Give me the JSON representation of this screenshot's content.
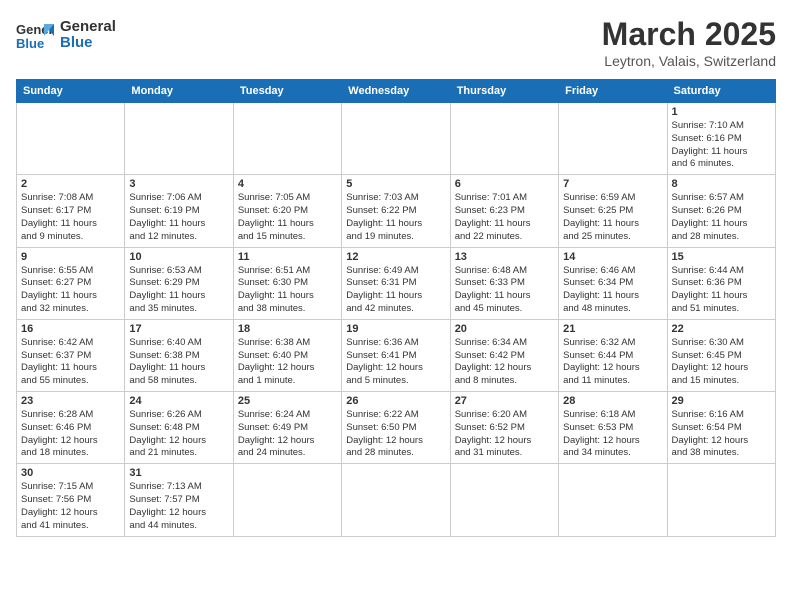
{
  "logo": {
    "line1": "General",
    "line2": "Blue"
  },
  "title": "March 2025",
  "subtitle": "Leytron, Valais, Switzerland",
  "weekdays": [
    "Sunday",
    "Monday",
    "Tuesday",
    "Wednesday",
    "Thursday",
    "Friday",
    "Saturday"
  ],
  "weeks": [
    [
      {
        "day": "",
        "info": ""
      },
      {
        "day": "",
        "info": ""
      },
      {
        "day": "",
        "info": ""
      },
      {
        "day": "",
        "info": ""
      },
      {
        "day": "",
        "info": ""
      },
      {
        "day": "",
        "info": ""
      },
      {
        "day": "1",
        "info": "Sunrise: 7:10 AM\nSunset: 6:16 PM\nDaylight: 11 hours\nand 6 minutes."
      }
    ],
    [
      {
        "day": "2",
        "info": "Sunrise: 7:08 AM\nSunset: 6:17 PM\nDaylight: 11 hours\nand 9 minutes."
      },
      {
        "day": "3",
        "info": "Sunrise: 7:06 AM\nSunset: 6:19 PM\nDaylight: 11 hours\nand 12 minutes."
      },
      {
        "day": "4",
        "info": "Sunrise: 7:05 AM\nSunset: 6:20 PM\nDaylight: 11 hours\nand 15 minutes."
      },
      {
        "day": "5",
        "info": "Sunrise: 7:03 AM\nSunset: 6:22 PM\nDaylight: 11 hours\nand 19 minutes."
      },
      {
        "day": "6",
        "info": "Sunrise: 7:01 AM\nSunset: 6:23 PM\nDaylight: 11 hours\nand 22 minutes."
      },
      {
        "day": "7",
        "info": "Sunrise: 6:59 AM\nSunset: 6:25 PM\nDaylight: 11 hours\nand 25 minutes."
      },
      {
        "day": "8",
        "info": "Sunrise: 6:57 AM\nSunset: 6:26 PM\nDaylight: 11 hours\nand 28 minutes."
      }
    ],
    [
      {
        "day": "9",
        "info": "Sunrise: 6:55 AM\nSunset: 6:27 PM\nDaylight: 11 hours\nand 32 minutes."
      },
      {
        "day": "10",
        "info": "Sunrise: 6:53 AM\nSunset: 6:29 PM\nDaylight: 11 hours\nand 35 minutes."
      },
      {
        "day": "11",
        "info": "Sunrise: 6:51 AM\nSunset: 6:30 PM\nDaylight: 11 hours\nand 38 minutes."
      },
      {
        "day": "12",
        "info": "Sunrise: 6:49 AM\nSunset: 6:31 PM\nDaylight: 11 hours\nand 42 minutes."
      },
      {
        "day": "13",
        "info": "Sunrise: 6:48 AM\nSunset: 6:33 PM\nDaylight: 11 hours\nand 45 minutes."
      },
      {
        "day": "14",
        "info": "Sunrise: 6:46 AM\nSunset: 6:34 PM\nDaylight: 11 hours\nand 48 minutes."
      },
      {
        "day": "15",
        "info": "Sunrise: 6:44 AM\nSunset: 6:36 PM\nDaylight: 11 hours\nand 51 minutes."
      }
    ],
    [
      {
        "day": "16",
        "info": "Sunrise: 6:42 AM\nSunset: 6:37 PM\nDaylight: 11 hours\nand 55 minutes."
      },
      {
        "day": "17",
        "info": "Sunrise: 6:40 AM\nSunset: 6:38 PM\nDaylight: 11 hours\nand 58 minutes."
      },
      {
        "day": "18",
        "info": "Sunrise: 6:38 AM\nSunset: 6:40 PM\nDaylight: 12 hours\nand 1 minute."
      },
      {
        "day": "19",
        "info": "Sunrise: 6:36 AM\nSunset: 6:41 PM\nDaylight: 12 hours\nand 5 minutes."
      },
      {
        "day": "20",
        "info": "Sunrise: 6:34 AM\nSunset: 6:42 PM\nDaylight: 12 hours\nand 8 minutes."
      },
      {
        "day": "21",
        "info": "Sunrise: 6:32 AM\nSunset: 6:44 PM\nDaylight: 12 hours\nand 11 minutes."
      },
      {
        "day": "22",
        "info": "Sunrise: 6:30 AM\nSunset: 6:45 PM\nDaylight: 12 hours\nand 15 minutes."
      }
    ],
    [
      {
        "day": "23",
        "info": "Sunrise: 6:28 AM\nSunset: 6:46 PM\nDaylight: 12 hours\nand 18 minutes."
      },
      {
        "day": "24",
        "info": "Sunrise: 6:26 AM\nSunset: 6:48 PM\nDaylight: 12 hours\nand 21 minutes."
      },
      {
        "day": "25",
        "info": "Sunrise: 6:24 AM\nSunset: 6:49 PM\nDaylight: 12 hours\nand 24 minutes."
      },
      {
        "day": "26",
        "info": "Sunrise: 6:22 AM\nSunset: 6:50 PM\nDaylight: 12 hours\nand 28 minutes."
      },
      {
        "day": "27",
        "info": "Sunrise: 6:20 AM\nSunset: 6:52 PM\nDaylight: 12 hours\nand 31 minutes."
      },
      {
        "day": "28",
        "info": "Sunrise: 6:18 AM\nSunset: 6:53 PM\nDaylight: 12 hours\nand 34 minutes."
      },
      {
        "day": "29",
        "info": "Sunrise: 6:16 AM\nSunset: 6:54 PM\nDaylight: 12 hours\nand 38 minutes."
      }
    ],
    [
      {
        "day": "30",
        "info": "Sunrise: 7:15 AM\nSunset: 7:56 PM\nDaylight: 12 hours\nand 41 minutes."
      },
      {
        "day": "31",
        "info": "Sunrise: 7:13 AM\nSunset: 7:57 PM\nDaylight: 12 hours\nand 44 minutes."
      },
      {
        "day": "",
        "info": ""
      },
      {
        "day": "",
        "info": ""
      },
      {
        "day": "",
        "info": ""
      },
      {
        "day": "",
        "info": ""
      },
      {
        "day": "",
        "info": ""
      }
    ]
  ]
}
